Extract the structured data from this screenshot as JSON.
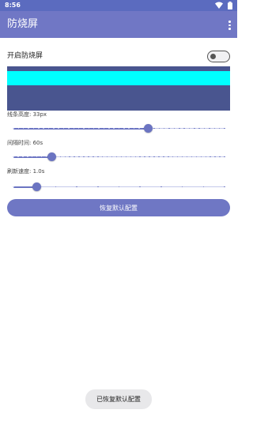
{
  "status_bar": {
    "time": "8:56",
    "icons": [
      "wifi-icon",
      "battery-icon"
    ]
  },
  "app_bar": {
    "title": "防烧屏",
    "menu_icon": "more-vert-icon"
  },
  "switch": {
    "label": "开启防烧屏",
    "checked": false
  },
  "preview": {
    "bar_color": "#00FFFF",
    "background_color": "#49558F"
  },
  "settings": [
    {
      "label": "线条高度: 33px",
      "fraction": 0.64,
      "ticks": 42
    },
    {
      "label": "间隔时间: 60s",
      "fraction": 0.18,
      "ticks": 45
    },
    {
      "label": "刷新速度: 1.0s",
      "fraction": 0.11,
      "ticks": 10
    }
  ],
  "reset_button": {
    "label": "恢复默认配置"
  },
  "toast": {
    "text": "已恢复默认配置"
  },
  "colors": {
    "primary": "#7077C5",
    "status_bar": "#5B6BBF",
    "accent": "#6B74C2"
  }
}
